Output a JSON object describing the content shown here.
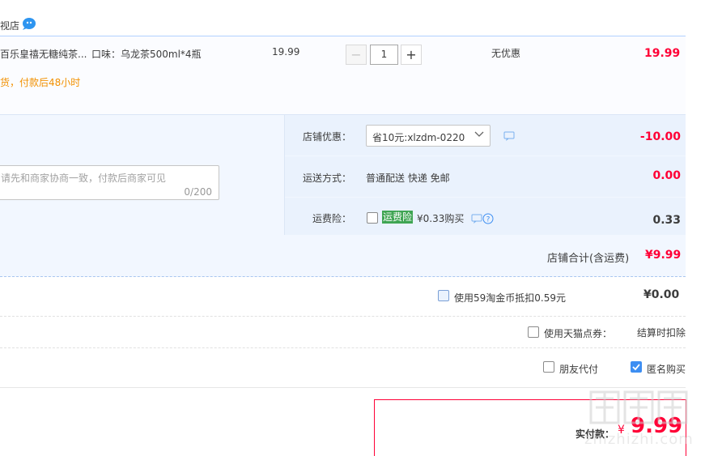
{
  "shop": {
    "name": "视店"
  },
  "item": {
    "title": "百乐皇禧无糖纯茶...",
    "spec": "口味：乌龙茶500ml*4瓶",
    "price": "19.99",
    "quantity": "1",
    "promo": "无优惠",
    "subtotal": "19.99",
    "shipping_note": "货，付款后48小时"
  },
  "memo": {
    "placeholder": "请先和商家协商一致，付款后商家可见",
    "count": "0/200"
  },
  "options": {
    "shop_discount_label": "店铺优惠：",
    "shop_discount_selected": "省10元:xlzdm-0220",
    "shop_discount_value": "-10.00",
    "shipping_label": "运送方式：",
    "shipping_method": "普通配送 快递 免邮",
    "shipping_value": "0.00",
    "insurance_label": "运费险：",
    "insurance_tag": "运费险",
    "insurance_price": "¥0.33购买",
    "insurance_value": "0.33"
  },
  "shop_total": {
    "label": "店铺合计(含运费)",
    "value": "¥9.99"
  },
  "coins": {
    "label": "使用59淘金币抵扣0.59元",
    "value": "¥0.00"
  },
  "tmall_points": {
    "label": "使用天猫点券：",
    "note": "结算时扣除"
  },
  "extra": {
    "friend_pay": "朋友代付",
    "anonymous": "匿名购买"
  },
  "payment": {
    "label": "实付款：",
    "currency": "¥",
    "value": "9.99"
  },
  "watermark": {
    "text": "zhizhizhi.com"
  },
  "colors": {
    "price_red": "#ff0036",
    "accent_blue": "#3d8ef2",
    "insurance_green": "#3fa553",
    "ship_orange": "#f29000"
  }
}
